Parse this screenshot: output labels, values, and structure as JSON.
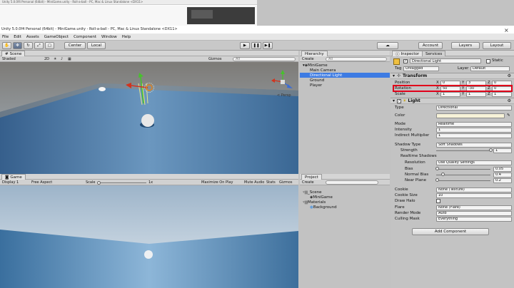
{
  "top_strip": {
    "title": "Unity 5.0.0f4 Personal (64bit) - MiniGame.unity - Roll-a-ball - PC, Mac & Linux Standalone <DX11>"
  },
  "window": {
    "title": "Unity 5.0.0f4 Personal (64bit) - MiniGame.unity - Roll-a-ball - PC, Mac & Linux Standalone <DX11>",
    "close": "×"
  },
  "menu": [
    "File",
    "Edit",
    "Assets",
    "GameObject",
    "Component",
    "Window",
    "Help"
  ],
  "toolbar": {
    "center_label": "Center",
    "local_label": "Local",
    "collab": "Collab",
    "account": "Account",
    "layers": "Layers",
    "layout": "Layout"
  },
  "scene": {
    "tab": "Scene",
    "shading": "Shaded",
    "mode2d": "2D",
    "gizmos": "Gizmos",
    "search_placeholder": "All",
    "persp": "< Persp"
  },
  "game": {
    "tab": "Game",
    "display": "Display 1",
    "aspect": "Free Aspect",
    "scale_label": "Scale",
    "scale_value": "1x",
    "maximize": "Maximize On Play",
    "mute": "Mute Audio",
    "stats": "Stats",
    "gizmos": "Gizmos"
  },
  "hierarchy": {
    "tab": "Hierarchy",
    "create": "Create",
    "search_placeholder": "All",
    "root": "MiniGame",
    "items": [
      "Main Camera",
      "Directional Light",
      "Ground",
      "Player"
    ],
    "selected_index": 1
  },
  "project": {
    "tab": "Project",
    "create": "Create",
    "items": [
      {
        "label": "_Scene",
        "depth": 0
      },
      {
        "label": "MiniGame",
        "depth": 1
      },
      {
        "label": "Materials",
        "depth": 0
      },
      {
        "label": "Background",
        "depth": 1
      }
    ]
  },
  "inspector": {
    "tab": "Inspector",
    "tab2": "Services",
    "object_name": "Directional Light",
    "static_label": "Static",
    "tag_label": "Tag",
    "tag_value": "Untagged",
    "layer_label": "Layer",
    "layer_value": "Default",
    "transform": {
      "title": "Transform",
      "rows": [
        {
          "label": "Position",
          "x": "0",
          "y": "3",
          "z": "0"
        },
        {
          "label": "Rotation",
          "x": "50",
          "y": "-30",
          "z": "0"
        },
        {
          "label": "Scale",
          "x": "1",
          "y": "1",
          "z": "1"
        }
      ]
    },
    "light": {
      "title": "Light",
      "type_label": "Type",
      "type_value": "Directional",
      "color_label": "Color",
      "color_value": "#f7f2d8",
      "mode_label": "Mode",
      "mode_value": "Realtime",
      "intensity_label": "Intensity",
      "intensity_value": "1",
      "indirect_label": "Indirect Multiplier",
      "indirect_value": "1",
      "shadow_label": "Shadow Type",
      "shadow_value": "Soft Shadows",
      "strength_label": "Strength",
      "strength_value": "1",
      "strength_frac": 1.0,
      "rs_label": "Realtime Shadows",
      "resolution_label": "Resolution",
      "resolution_value": "Use Quality Settings",
      "bias_label": "Bias",
      "bias_value": "0.05",
      "bias_frac": 0.025,
      "nbias_label": "Normal Bias",
      "nbias_value": "0.4",
      "nbias_frac": 0.13,
      "nplane_label": "Near Plane",
      "nplane_value": "0.2",
      "nplane_frac": 0.02,
      "cookie_label": "Cookie",
      "cookie_value": "None (Texture)",
      "cookie_size_label": "Cookie Size",
      "cookie_size_value": "10",
      "draw_halo_label": "Draw Halo",
      "flare_label": "Flare",
      "flare_value": "None (Flare)",
      "render_label": "Render Mode",
      "render_value": "Auto",
      "culling_label": "Culling Mask",
      "culling_value": "Everything"
    },
    "add_component": "Add Component"
  },
  "colors": {
    "highlight": "#e0001a",
    "selection": "#3d7be3",
    "sky": "#a9c3dc",
    "ground": "#3f73a6"
  }
}
